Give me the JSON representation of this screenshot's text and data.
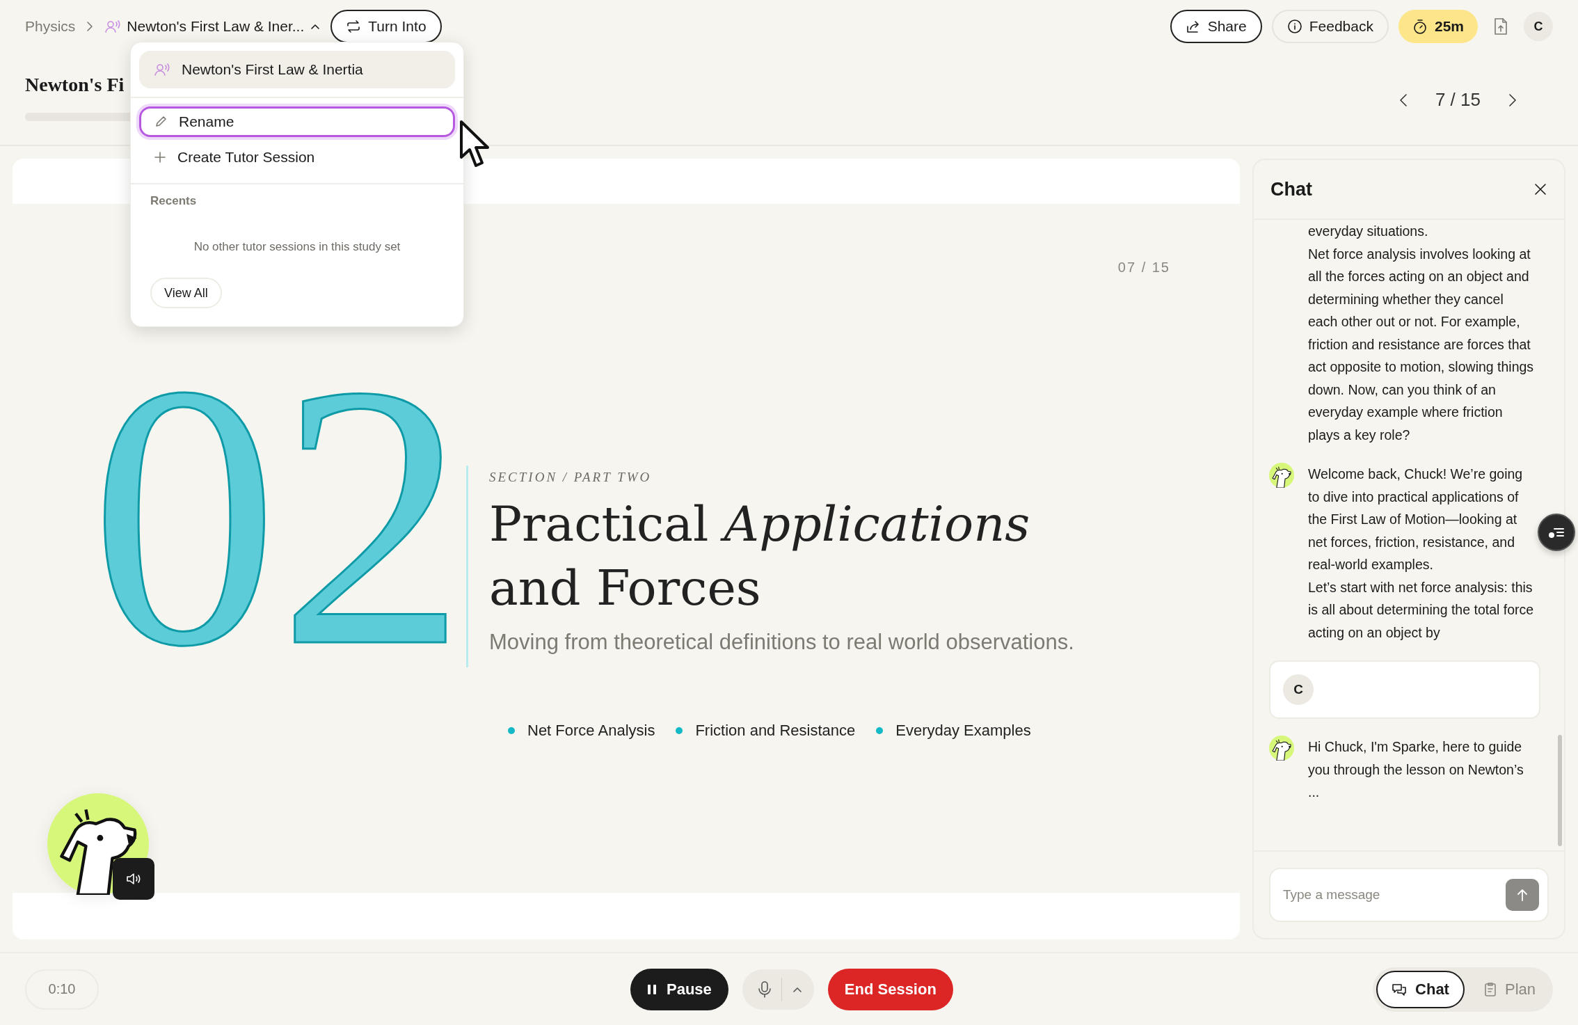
{
  "breadcrumb": {
    "subject": "Physics",
    "session": "Newton's First Law & Iner...",
    "turn_into": "Turn Into"
  },
  "actions": {
    "share": "Share",
    "feedback": "Feedback",
    "timer": "25m",
    "avatar": "C"
  },
  "title": "Newton's Fi",
  "page_nav": {
    "current": "7 / 15"
  },
  "menu": {
    "items": [
      {
        "kind": "session",
        "label": "Newton's First Law & Inertia",
        "selected": true,
        "highlighted": false
      },
      {
        "kind": "rename",
        "label": "Rename",
        "selected": false,
        "highlighted": true
      },
      {
        "kind": "create",
        "label": "Create Tutor Session",
        "selected": false,
        "highlighted": false
      }
    ],
    "recents_label": "Recents",
    "empty_text": "No other tutor sessions in this study set",
    "view_all": "View All"
  },
  "slide": {
    "page": "07 / 15",
    "number": "02",
    "eyebrow": "SECTION / PART TWO",
    "heading": "Practical *Applications*\nand Forces",
    "subtitle": "Moving from theoretical definitions to real world observations.",
    "bullets": [
      "Net Force Analysis",
      "Friction and Resistance",
      "Everyday Examples"
    ]
  },
  "chat": {
    "title": "Chat",
    "messages": [
      {
        "kind": "bot-continued",
        "paragraphs": [
          "everyday situations.",
          "Net force analysis involves looking at all the forces acting on an object and determining whether they cancel each other out or not. For example, friction and resistance are forces that act opposite to motion, slowing things down. Now, can you think of an everyday example where friction plays a key role?"
        ]
      },
      {
        "kind": "bot",
        "paragraphs": [
          "Welcome back, Chuck! We’re going to dive into practical applications of the First Law of Motion—looking at net forces, friction, resistance, and real-world examples.",
          "Let’s start with net force analysis: this is all about determining the total force acting on an object by"
        ]
      },
      {
        "kind": "user",
        "initial": "C"
      },
      {
        "kind": "bot",
        "paragraphs": [
          "Hi Chuck, I'm Sparke, here to guide you through the lesson on Newton’s ..."
        ]
      }
    ],
    "input": {
      "placeholder": "Type a message"
    }
  },
  "footer": {
    "elapsed": "0:10",
    "pause": "Pause",
    "end": "End Session",
    "views": [
      {
        "kind": "chat",
        "label": "Chat",
        "selected": true
      },
      {
        "kind": "plan",
        "label": "Plan",
        "selected": false
      }
    ]
  }
}
